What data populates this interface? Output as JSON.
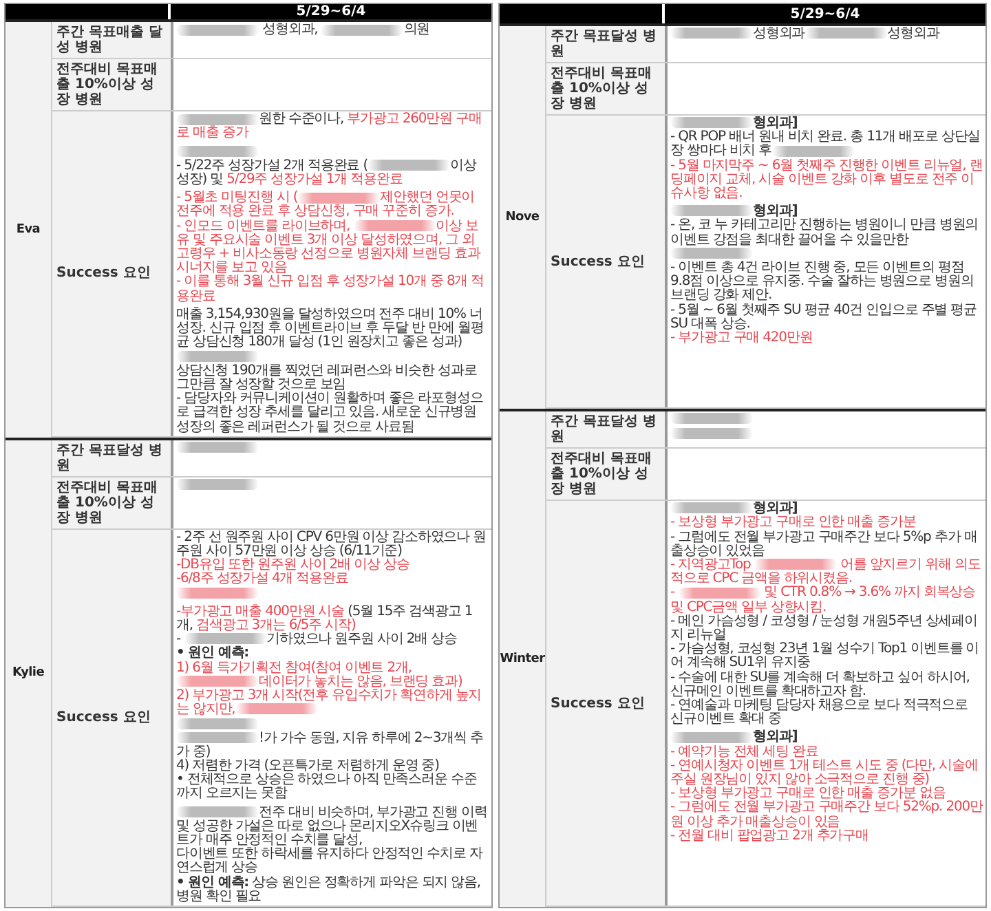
{
  "panels": [
    {
      "period": "5/29~6/4",
      "people": [
        {
          "name": "Eva",
          "rows": [
            {
              "label": "주간 목표매출 달성 병원",
              "sections": [
                [
                  [
                    {
                      "kind": "blur",
                      "color": "#bbbbbb"
                    },
                    {
                      "kind": "text",
                      "text": " 성형외과, ",
                      "color": "#333333"
                    },
                    {
                      "kind": "blur",
                      "color": "#bbbbbb"
                    },
                    {
                      "kind": "text",
                      "text": "의원",
                      "color": "#333333"
                    }
                  ]
                ]
              ]
            },
            {
              "label": "전주대비 목표매출 10%이상 성장 병원"
            },
            {
              "label": "Success 요인",
              "sections": [
                [
                  [
                    {
                      "kind": "blur",
                      "color": "#bbbbbb"
                    },
                    {
                      "kind": "text",
                      "text": "원한 수준이나, ",
                      "color": "#333333"
                    },
                    {
                      "kind": "text",
                      "text": "부가광고 260만원 구매로 매출 증가",
                      "color": "#e8464f"
                    }
                  ]
                ],
                [
                  [
                    {
                      "kind": "blur",
                      "color": "#bbbbbb"
                    }
                  ],
                  [
                    {
                      "kind": "text",
                      "text": "- 5/22주 성장가설 2개 적용완료 (",
                      "color": "#333333"
                    },
                    {
                      "kind": "blur",
                      "color": "#bbbbbb"
                    },
                    {
                      "kind": "text",
                      "text": "이상 성장) 및 ",
                      "color": "#333333"
                    },
                    {
                      "kind": "text",
                      "text": "5/29주 성장가설 1개 적용완료",
                      "color": "#e8464f"
                    }
                  ]
                ],
                [
                  [
                    {
                      "kind": "text",
                      "text": "- 5월초 미팅진행 시 (",
                      "color": "#e8464f"
                    },
                    {
                      "kind": "blur",
                      "color": "#f3a3a8"
                    },
                    {
                      "kind": "text",
                      "text": "제안했던 언못이 전주에 적용 완료 후 상담신청, 구매 꾸준히 증가.",
                      "color": "#e8464f"
                    }
                  ],
                  [
                    {
                      "kind": "text",
                      "text": "- 인모드 이벤트를 라이브하며, ",
                      "color": "#e8464f"
                    },
                    {
                      "kind": "blur",
                      "color": "#f3a3a8"
                    },
                    {
                      "kind": "text",
                      "text": "이상 보유 및 주요시술 이벤트 3개 이상 달성하였으며, 그 외 고령우 + 비사소동랑 선정으로 병원자체 브랜딩 효과 시너지를 보고 있음",
                      "color": "#e8464f"
                    }
                  ],
                  [
                    {
                      "kind": "text",
                      "text": "- 이를 통해 3월 신규 입점 후 성장가설 10개 중 8개 적용완료",
                      "color": "#e8464f"
                    }
                  ]
                ],
                [
                  [
                    {
                      "kind": "text",
                      "text": "매출 3,154,930원을 달성하였으며 전주 대비 10% 너 성장. 신규 입점 후 이벤트라이브 후 두달 반 만에 월평균 상담신청 180개 달성 (1인 원장치고 좋은 성과)",
                      "color": "#333333"
                    }
                  ],
                  [
                    {
                      "kind": "blur",
                      "color": "#bbbbbb"
                    }
                  ],
                  [
                    {
                      "kind": "text",
                      "text": "상담신청 190개를 찍었던 레퍼런스와 비슷한 성과로 그만큼 잘 성장할 것으로 보임",
                      "color": "#333333"
                    }
                  ],
                  [
                    {
                      "kind": "text",
                      "text": "- 담당자와 커뮤니케이션이 원활하며 좋은 라포형성으로 급격한 성장 추세를 달리고 있음. 새로운 신규병원 성장의 좋은 레퍼런스가 될 것으로 사료됨",
                      "color": "#333333"
                    }
                  ]
                ]
              ]
            }
          ]
        },
        {
          "name": "Kylie",
          "rows": [
            {
              "label": "주간 목표달성 병원",
              "sections": [
                [
                  [
                    {
                      "kind": "blur",
                      "color": "#bbbbbb"
                    }
                  ]
                ]
              ]
            },
            {
              "label": "전주대비 목표매출 10%이상 성장 병원",
              "sections": [
                [
                  [
                    {
                      "kind": "blur",
                      "color": "#bbbbbb"
                    }
                  ]
                ]
              ]
            },
            {
              "label": "Success 요인",
              "sections": [
                [
                  [
                    {
                      "kind": "text",
                      "text": "- 2주 선 원주원 사이 CPV 6만원 이상 감소하였으나 원주원 사이 57만원 이상 상승 (6/11기준)",
                      "color": "#333333"
                    }
                  ],
                  [
                    {
                      "kind": "text",
                      "text": "-DB유입 또한 원주원 사이 2배 이상 상승",
                      "color": "#e8464f"
                    }
                  ],
                  [
                    {
                      "kind": "text",
                      "text": "-6/8주 성장가설 4개 적용완료",
                      "color": "#e8464f"
                    }
                  ],
                  [
                    {
                      "kind": "blur",
                      "color": "#f3a3a8"
                    }
                  ]
                ],
                [
                  [
                    {
                      "kind": "text",
                      "text": "-부가광고 매출 400만원 시술",
                      "color": "#e8464f"
                    },
                    {
                      "kind": "text",
                      "text": " (5월 15주 검색광고 1개, ",
                      "color": "#333333"
                    },
                    {
                      "kind": "text",
                      "text": "검색광고 3개는 6/5주 시작)",
                      "color": "#e8464f"
                    }
                  ],
                  [
                    {
                      "kind": "text",
                      "text": "- ",
                      "color": "#333333"
                    },
                    {
                      "kind": "blur",
                      "color": "#bbbbbb"
                    },
                    {
                      "kind": "text",
                      "text": "기하였으나 원주원 사이 2배 상승",
                      "color": "#333333"
                    }
                  ],
                  [
                    {
                      "kind": "text",
                      "text": "• 원인 예측:",
                      "color": "#333333",
                      "bold": true
                    }
                  ],
                  [
                    {
                      "kind": "text",
                      "text": "1) 6월 득가기획전 참여(참여 이벤트 2개, ",
                      "color": "#e8464f"
                    },
                    {
                      "kind": "blur",
                      "color": "#f3a3a8"
                    },
                    {
                      "kind": "text",
                      "text": "데이터가 놓치는 않음, 브랜딩 효과)",
                      "color": "#e8464f"
                    }
                  ],
                  [
                    {
                      "kind": "text",
                      "text": "2) 부가광고 3개 시작(전후 유입수치가 확연하게 높지는 않지만,",
                      "color": "#e8464f"
                    },
                    {
                      "kind": "blur",
                      "color": "#f3a3a8"
                    }
                  ],
                  [
                    {
                      "kind": "blur",
                      "color": "#bbbbbb"
                    }
                  ],
                  [
                    {
                      "kind": "blur",
                      "color": "#bbbbbb"
                    },
                    {
                      "kind": "text",
                      "text": "!가 가수 동원, 지유 하루에 2~3개씩 추가 중)",
                      "color": "#333333"
                    }
                  ],
                  [
                    {
                      "kind": "text",
                      "text": "4) 저렴한 가격 (오픈특가로 저렴하게 운영 중)",
                      "color": "#333333"
                    }
                  ],
                  [
                    {
                      "kind": "text",
                      "text": "• 전체적으로 상승은 하였으나 아직 만족스러운 수준까지 오르지는 못함",
                      "color": "#333333"
                    }
                  ]
                ],
                [
                  [
                    {
                      "kind": "blur",
                      "color": "#bbbbbb"
                    },
                    {
                      "kind": "text",
                      "text": "전주 대비 비슷하며, 부가광고 진행 이력 및 성공한 가설은 따로 없으나 몬리지오X슈링크 이벤트가 매주 안정적인 수치를 달성,",
                      "color": "#333333"
                    }
                  ],
                  [
                    {
                      "kind": "text",
                      "text": "다이벤트 또한 하락세를 유지하다 안정적인 수치로 자연스럽게 상승",
                      "color": "#333333"
                    }
                  ],
                  [
                    {
                      "kind": "text",
                      "text": "• 원인 예측:",
                      "color": "#333333",
                      "bold": true
                    },
                    {
                      "kind": "text",
                      "text": " 상승 원인은 정확하게 파악은 되지 않음, 병원 확인 필요",
                      "color": "#333333"
                    }
                  ]
                ]
              ]
            }
          ]
        }
      ]
    },
    {
      "period": "5/29~6/4",
      "people": [
        {
          "name": "Nove",
          "rows": [
            {
              "label": "주간 목표달성 병원",
              "sections": [
                [
                  [
                    {
                      "kind": "blur",
                      "color": "#bbbbbb"
                    },
                    {
                      "kind": "text",
                      "text": "성형외과",
                      "color": "#333333"
                    },
                    {
                      "kind": "blur",
                      "color": "#bbbbbb"
                    },
                    {
                      "kind": "text",
                      "text": "성형외과",
                      "color": "#333333"
                    }
                  ]
                ]
              ]
            },
            {
              "label": "전주대비 목표매출 10%이상 성장 병원"
            },
            {
              "label": "Success 요인",
              "sections": [
                [
                  [
                    {
                      "kind": "blur",
                      "color": "#bbbbbb"
                    },
                    {
                      "kind": "text",
                      "text": "형외과]",
                      "color": "#333333",
                      "bold": true
                    }
                  ],
                  [
                    {
                      "kind": "text",
                      "text": "- QR POP 배너 원내 비치 완료. 총 11개 배포로 상단실장 쌍마다 비치 후",
                      "color": "#333333"
                    },
                    {
                      "kind": "blur",
                      "color": "#bbbbbb"
                    }
                  ],
                  [
                    {
                      "kind": "text",
                      "text": "- 5월 마지막주 ~ 6월 첫째주 진행한 이벤트 리뉴얼, 랜딩페이지 교체, 시술 이벤트 강화 이후 별도로 전주 이슈사항 없음.",
                      "color": "#e8464f"
                    }
                  ]
                ],
                [
                  [
                    {
                      "kind": "blur",
                      "color": "#bbbbbb"
                    },
                    {
                      "kind": "text",
                      "text": "형외과]",
                      "color": "#333333",
                      "bold": true
                    }
                  ],
                  [
                    {
                      "kind": "text",
                      "text": "- 온, 코 누 카테고리만 진행하는 병원이니 만큼 병원의 이벤트 강점을 최대한 끌어올 수 있을만한",
                      "color": "#333333"
                    },
                    {
                      "kind": "blur",
                      "color": "#bbbbbb"
                    }
                  ],
                  [
                    {
                      "kind": "text",
                      "text": "- 이벤트 총 4건 라이브 진행 중, 모든 이벤트의 평점 9.8점 이상으로 유지중. 수술 잘하는 병원으로 병원의 브랜딩 강화 제안.",
                      "color": "#333333"
                    }
                  ],
                  [
                    {
                      "kind": "text",
                      "text": "- 5월 ~ 6월 첫째주 SU 평균 40건 인입으로 주별 평균 SU 대폭 상승.",
                      "color": "#333333"
                    }
                  ],
                  [
                    {
                      "kind": "text",
                      "text": "- 부가광고 구매 420만원",
                      "color": "#e8464f"
                    }
                  ]
                ]
              ]
            }
          ]
        },
        {
          "name": "Winter",
          "rows": [
            {
              "label": "주간 목표달성 병원",
              "sections": [
                [
                  [
                    {
                      "kind": "blur",
                      "color": "#bbbbbb"
                    }
                  ],
                  [
                    {
                      "kind": "blur",
                      "color": "#bbbbbb"
                    }
                  ]
                ]
              ]
            },
            {
              "label": "전주대비 목표매출 10%이상 성장 병원"
            },
            {
              "label": "Success 요인",
              "sections": [
                [
                  [
                    {
                      "kind": "blur",
                      "color": "#bbbbbb"
                    },
                    {
                      "kind": "text",
                      "text": "형외과]",
                      "color": "#333333",
                      "bold": true
                    }
                  ],
                  [
                    {
                      "kind": "text",
                      "text": "- 보상형 부가광고 구매로 인한 매출 증가분",
                      "color": "#e8464f"
                    }
                  ],
                  [
                    {
                      "kind": "text",
                      "text": "- 그럼에도 전월 부가광고 구매주간 보다 5%p 추가 매출상승이 있었음",
                      "color": "#333333"
                    }
                  ],
                  [
                    {
                      "kind": "text",
                      "text": "- 지역광고Top ",
                      "color": "#e8464f"
                    },
                    {
                      "kind": "blur",
                      "color": "#f3a3a8"
                    },
                    {
                      "kind": "text",
                      "text": " 어를 앞지르기 위해 의도적으로 CPC 금액을 하위시켰음.",
                      "color": "#e8464f"
                    }
                  ],
                  [
                    {
                      "kind": "text",
                      "text": "- ",
                      "color": "#e8464f"
                    },
                    {
                      "kind": "blur",
                      "color": "#f3a3a8"
                    },
                    {
                      "kind": "text",
                      "text": " 및 CTR 0.8% → 3.6% 까지 회복상승 및 CPC금액 일부 상향시킴.",
                      "color": "#e8464f"
                    }
                  ],
                  [
                    {
                      "kind": "text",
                      "text": "- 메인 가슴성형 / 코성형 / 눈성형 개원5주년 상세페이지 리뉴얼",
                      "color": "#333333"
                    }
                  ],
                  [
                    {
                      "kind": "text",
                      "text": "- 가슴성형, 코성형 23년 1월 성수기 Top1 이벤트를 이어 계속해 SU1위 유지중",
                      "color": "#333333"
                    }
                  ],
                  [
                    {
                      "kind": "text",
                      "text": "- 수술에 대한 SU를 계속해 더 확보하고 싶어 하시어, 신규메인 이벤트를 확대하고자 함.",
                      "color": "#333333"
                    }
                  ],
                  [
                    {
                      "kind": "text",
                      "text": "- 연예술과 마케팅 담당자 채용으로 보다 적극적으로 신규이벤트 확대 중",
                      "color": "#333333"
                    }
                  ]
                ],
                [
                  [
                    {
                      "kind": "blur",
                      "color": "#bbbbbb"
                    },
                    {
                      "kind": "text",
                      "text": "형외과]",
                      "color": "#333333",
                      "bold": true
                    }
                  ],
                  [
                    {
                      "kind": "text",
                      "text": "- 예약기능 전체 세팅 완료",
                      "color": "#e8464f"
                    }
                  ],
                  [
                    {
                      "kind": "text",
                      "text": "- 연예시청자 이벤트 1개 테스트 시도 중 (다만, 시술에 주실 원장님이 있지 않아 소극적으로 진행 중)",
                      "color": "#e8464f"
                    }
                  ],
                  [
                    {
                      "kind": "text",
                      "text": "- 보상형 부가광고 구매로 인한 매출 증가분 없음",
                      "color": "#e8464f"
                    }
                  ],
                  [
                    {
                      "kind": "text",
                      "text": "- 그럼에도 전월 부가광고 구매주간 보다 52%p. 200만원 이상 추가 매출상승이 있음",
                      "color": "#e8464f"
                    }
                  ],
                  [
                    {
                      "kind": "text",
                      "text": "- 전월 대비 팝업광고 2개 추가구매",
                      "color": "#e8464f"
                    }
                  ]
                ]
              ]
            }
          ]
        }
      ]
    }
  ]
}
